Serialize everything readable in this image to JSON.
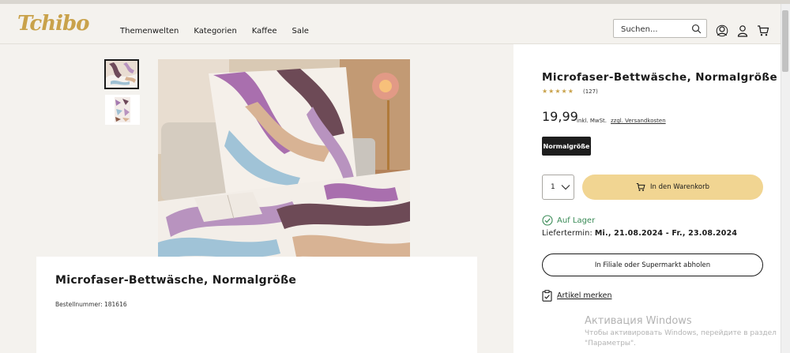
{
  "header": {
    "logo_text": "Tchibo",
    "nav": [
      "Themenwelten",
      "Kategorien",
      "Kaffee",
      "Sale"
    ],
    "search_placeholder": "Suchen...",
    "icons": [
      "search-icon",
      "account-switch-icon",
      "user-icon",
      "cart-icon"
    ]
  },
  "gallery": {
    "thumbnails": [
      "thumbnail-1",
      "thumbnail-2"
    ],
    "active_thumbnail": 0
  },
  "product": {
    "title": "Microfaser-Bettwäsche, Normalgröße",
    "rating_stars": "★★★★★",
    "rating": 4.5,
    "review_count": "(127)",
    "price": "19,99",
    "vat_text": "inkl. MwSt.",
    "shipping_link": "zzgl. Versandkosten",
    "size_option": "Normalgröße",
    "quantity": "1",
    "add_to_cart": "In den Warenkorb",
    "stock_status": "Auf Lager",
    "delivery_label": "Liefertermin:",
    "delivery_dates": "Mi., 21.08.2024 - Fr., 23.08.2024",
    "pickup_button": "In Filiale oder Supermarkt abholen",
    "wishlist_link": "Artikel merken"
  },
  "details": {
    "title": "Microfaser-Bettwäsche, Normalgröße",
    "order_number": "Bestellnummer: 181616"
  },
  "watermark": {
    "line1": "Активация Windows",
    "line2": "Чтобы активировать Windows, перейдите в раздел",
    "line3": "\"Параметры\"."
  },
  "colors": {
    "brand_gold": "#c9a24b",
    "cart_button": "#f1d592",
    "stock_green": "#3a8b57",
    "chip_dark": "#1e1e1e"
  }
}
